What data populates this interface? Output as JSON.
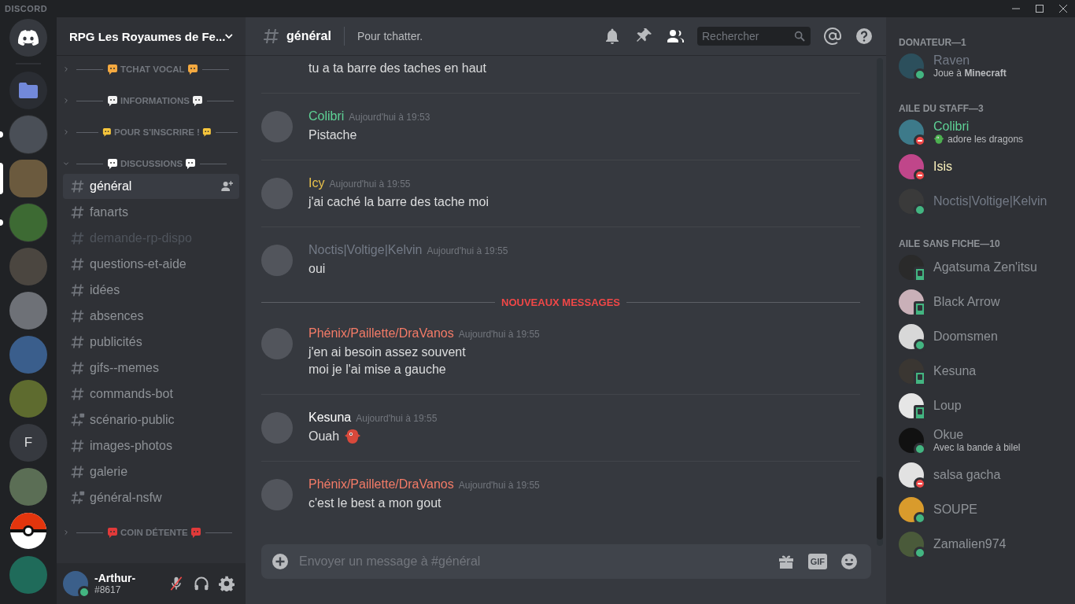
{
  "titlebar": {
    "logo": "DISCORD"
  },
  "servers": [
    {
      "kind": "home",
      "selected": false,
      "unread": false
    },
    {
      "kind": "folder",
      "selected": false,
      "unread": false
    },
    {
      "kind": "avatar",
      "selected": false,
      "unread": true
    },
    {
      "kind": "avatar",
      "selected": true,
      "unread": false
    },
    {
      "kind": "avatar",
      "selected": false,
      "unread": true
    },
    {
      "kind": "avatar",
      "selected": false,
      "unread": false
    },
    {
      "kind": "avatar",
      "selected": false,
      "unread": false
    },
    {
      "kind": "avatar",
      "selected": false,
      "unread": false
    },
    {
      "kind": "avatar",
      "selected": false,
      "unread": false
    },
    {
      "kind": "letter",
      "label": "F",
      "selected": false,
      "unread": false
    },
    {
      "kind": "avatar",
      "selected": false,
      "unread": false
    },
    {
      "kind": "ball",
      "selected": false,
      "unread": false
    },
    {
      "kind": "avatar",
      "selected": false,
      "unread": false
    }
  ],
  "sidebar": {
    "server_name": "RPG Les Royaumes de Fe...",
    "categories": [
      {
        "label": "TCHAT VOCAL",
        "expanded": false
      },
      {
        "label": "INFORMATIONS",
        "expanded": false
      },
      {
        "label": "POUR S'INSCRIRE !",
        "expanded": false
      },
      {
        "label": "DISCUSSIONS",
        "expanded": true,
        "channels": [
          {
            "name": "général",
            "kind": "text",
            "selected": true,
            "muted": false
          },
          {
            "name": "fanarts",
            "kind": "text",
            "selected": false,
            "muted": false
          },
          {
            "name": "demande-rp-dispo",
            "kind": "text",
            "selected": false,
            "muted": true
          },
          {
            "name": "questions-et-aide",
            "kind": "text",
            "selected": false,
            "muted": false
          },
          {
            "name": "idées",
            "kind": "text",
            "selected": false,
            "muted": false
          },
          {
            "name": "absences",
            "kind": "text",
            "selected": false,
            "muted": false
          },
          {
            "name": "publicités",
            "kind": "text",
            "selected": false,
            "muted": false
          },
          {
            "name": "gifs--memes",
            "kind": "text",
            "selected": false,
            "muted": false
          },
          {
            "name": "commands-bot",
            "kind": "text",
            "selected": false,
            "muted": false
          },
          {
            "name": "scénario-public",
            "kind": "restricted",
            "selected": false,
            "muted": false
          },
          {
            "name": "images-photos",
            "kind": "text",
            "selected": false,
            "muted": false
          },
          {
            "name": "galerie",
            "kind": "text",
            "selected": false,
            "muted": false
          },
          {
            "name": "général-nsfw",
            "kind": "restricted",
            "selected": false,
            "muted": false
          }
        ]
      },
      {
        "label": "COIN DÉTENTE",
        "expanded": false
      }
    ],
    "user": {
      "name": "-Arthur-",
      "tag": "#8617",
      "online": true,
      "mic_muted": true
    }
  },
  "chat": {
    "channel": "général",
    "topic": "Pour tchatter.",
    "search": {
      "placeholder": "Rechercher"
    },
    "messages": [
      {
        "kind": "continuation",
        "lines": [
          "tu a ta barre des taches en haut"
        ]
      },
      {
        "kind": "message",
        "author": "Colibri",
        "color": "#5ed296",
        "time": "Aujourd'hui à 19:53",
        "lines": [
          "Pistache"
        ]
      },
      {
        "kind": "message",
        "author": "Icy",
        "color": "#e9c14b",
        "time": "Aujourd'hui à 19:55",
        "lines": [
          "j'ai caché la barre des tache moi"
        ]
      },
      {
        "kind": "message",
        "author": "Noctis|Voltige|Kelvin",
        "color": "#737a86",
        "time": "Aujourd'hui à 19:55",
        "lines": [
          "oui"
        ]
      },
      {
        "kind": "divider",
        "label": "NOUVEAUX MESSAGES"
      },
      {
        "kind": "message",
        "author": "Phénix/Paillette/DraVanos",
        "color": "#f47b67",
        "time": "Aujourd'hui à 19:55",
        "lines": [
          "j'en ai besoin assez souvent",
          "moi je l'ai mise a gauche"
        ]
      },
      {
        "kind": "message",
        "author": "Kesuna",
        "color": "#ffffff",
        "time": "Aujourd'hui à 19:55",
        "lines": [
          "Ouah"
        ],
        "emoji": true
      },
      {
        "kind": "message",
        "author": "Phénix/Paillette/DraVanos",
        "color": "#f47b67",
        "time": "Aujourd'hui à 19:55",
        "lines": [
          "c'est le best a mon gout"
        ]
      }
    ],
    "input": {
      "placeholder": "Envoyer un message à #général",
      "gif": "GIF"
    }
  },
  "members": [
    {
      "label": "DONATEUR—1",
      "members": [
        {
          "name": "Raven",
          "color": "#737a86",
          "kind": "online",
          "activity": "Joue à **Minecraft**"
        }
      ]
    },
    {
      "label": "AILE DU STAFF—3",
      "members": [
        {
          "name": "Colibri",
          "color": "#5ed296",
          "kind": "dnd",
          "activity": "adore les dragons",
          "activity_emoji": true
        },
        {
          "name": "Isis",
          "color": "#fdf3bd",
          "kind": "dnd"
        },
        {
          "name": "Noctis|Voltige|Kelvin",
          "color": "#737a86",
          "kind": "online"
        }
      ]
    },
    {
      "label": "AILE SANS FICHE—10",
      "members": [
        {
          "name": "Agatsuma Zen'itsu",
          "color": "#8e9297",
          "kind": "mobile"
        },
        {
          "name": "Black Arrow",
          "color": "#8e9297",
          "kind": "mobile"
        },
        {
          "name": "Doomsmen",
          "color": "#8e9297",
          "kind": "online"
        },
        {
          "name": "Kesuna",
          "color": "#8e9297",
          "kind": "mobile"
        },
        {
          "name": "Loup",
          "color": "#8e9297",
          "kind": "mobile"
        },
        {
          "name": "Okue",
          "color": "#8e9297",
          "kind": "online",
          "activity": "Avec la bande à bilel"
        },
        {
          "name": "salsa gacha",
          "color": "#8e9297",
          "kind": "dnd"
        },
        {
          "name": "SOUPE",
          "color": "#8e9297",
          "kind": "online"
        },
        {
          "name": "Zamalien974",
          "color": "#8e9297",
          "kind": "online"
        }
      ]
    }
  ]
}
